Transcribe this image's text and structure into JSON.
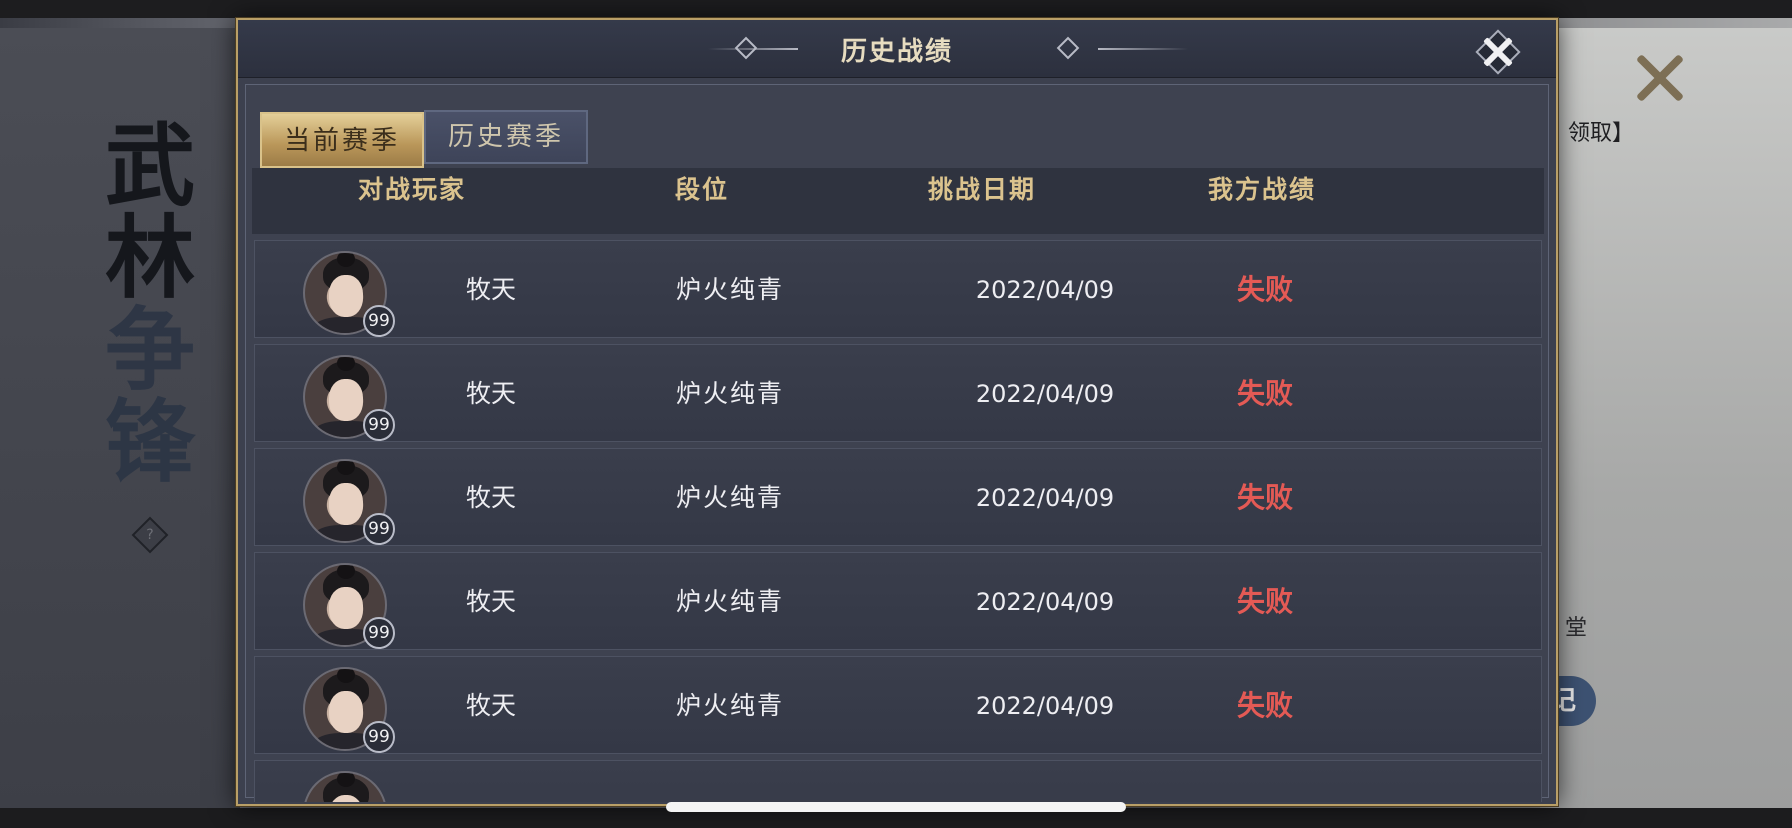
{
  "background": {
    "calligraphy": [
      "武",
      "林",
      "争",
      "锋"
    ],
    "help_glyph": "?",
    "right_text_top": "领取】",
    "right_text_mid": "堂",
    "right_button_fragment": "记"
  },
  "dialog": {
    "title": "历史战绩",
    "tabs": [
      {
        "label": "当前赛季",
        "active": true
      },
      {
        "label": "历史赛季",
        "active": false
      }
    ],
    "columns": [
      "对战玩家",
      "段位",
      "挑战日期",
      "我方战绩"
    ],
    "rows": [
      {
        "level": "99",
        "player": "牧天",
        "rank": "炉火纯青",
        "date": "2022/04/09",
        "result": "失败"
      },
      {
        "level": "99",
        "player": "牧天",
        "rank": "炉火纯青",
        "date": "2022/04/09",
        "result": "失败"
      },
      {
        "level": "99",
        "player": "牧天",
        "rank": "炉火纯青",
        "date": "2022/04/09",
        "result": "失败"
      },
      {
        "level": "99",
        "player": "牧天",
        "rank": "炉火纯青",
        "date": "2022/04/09",
        "result": "失败"
      },
      {
        "level": "99",
        "player": "牧天",
        "rank": "炉火纯青",
        "date": "2022/04/09",
        "result": "失败"
      }
    ]
  },
  "colors": {
    "accent_gold": "#dbc38e",
    "defeat_red": "#e45a55",
    "panel": "#3c404e"
  }
}
